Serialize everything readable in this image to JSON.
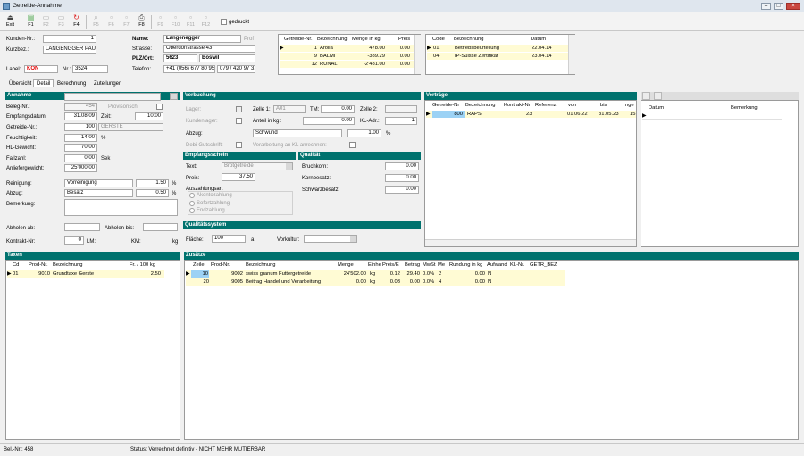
{
  "window": {
    "title": "Getreide-Annahme"
  },
  "toolbar": {
    "exit": "Exit",
    "f1": "F1",
    "f2": "F2",
    "f3": "F3",
    "f4": "F4",
    "f5": "F5",
    "f6": "F6",
    "f7": "F7",
    "f8": "F8",
    "f9": "F9",
    "f10": "F10",
    "f11": "F11",
    "f12": "F12",
    "gedruckt": "gedruckt"
  },
  "header": {
    "kundennr_label": "Kunden-Nr.:",
    "kundennr": "1",
    "kurzbez_label": "Kurzbez.:",
    "kurzbez": "LANGENGGER PAU",
    "label_label": "Label:",
    "label": "KON",
    "nr_label": "Nr.:",
    "nr": "3524",
    "name_label": "Name:",
    "name": "Langenegger",
    "name_extra": "Prof",
    "strasse_label": "Strasse:",
    "strasse": "Oberdorfstrasse 43",
    "plz_label": "PLZ/Ort:",
    "plz": "5623",
    "ort": "Boswil",
    "telefon_label": "Telefon:",
    "telefon": "+41 (056) 677 80 95",
    "telefon2": "079 / 420 97 31"
  },
  "getreide_table": {
    "headers": [
      "Getreide-Nr.",
      "Bezeichnung",
      "Menge in kg",
      "Preis"
    ],
    "rows": [
      [
        "1",
        "Arolla",
        "478.00",
        "0.00"
      ],
      [
        "9",
        "BALMI",
        "-389.29",
        "0.00"
      ],
      [
        "12",
        "RUNAL",
        "-2'481.00",
        "0.00"
      ]
    ]
  },
  "code_table": {
    "headers": [
      "Code",
      "Bezeichnung",
      "Datum"
    ],
    "rows": [
      [
        "01",
        "Betriebsbeurteilung",
        "22.04.14"
      ],
      [
        "04",
        "IP-Suisse Zertifikat",
        "23.04.14"
      ]
    ]
  },
  "tabs": [
    "Übersicht",
    "Detail",
    "Berechnung",
    "Zuteilungen"
  ],
  "annahme": {
    "section": "Annahme",
    "belegnr_label": "Beleg-Nr.:",
    "belegnr": "454",
    "provisorisch": "Provisorisch",
    "empfangsdatum_label": "Empfangsdatum:",
    "empfangsdatum": "31.08.09",
    "zeit_label": "Zeit:",
    "zeit": "10:00",
    "getreidenr_label": "Getreide-Nr.:",
    "getreidenr": "100",
    "getreide": "GERSTE",
    "feuchtigkeit_label": "Feuchtigkeit:",
    "feuchtigkeit": "14.00",
    "feuchtigkeit_unit": "%",
    "hlgewicht_label": "HL-Gewicht:",
    "hlgewicht": "70.00",
    "fallzahl_label": "Fallzahl:",
    "fallzahl": "0.00",
    "fallzahl_unit": "Sek",
    "anliefergewicht_label": "Anliefergewicht:",
    "anliefergewicht": "25'000.00",
    "reinigung_label": "Reinigung:",
    "reinigung": "Vorreinigung",
    "reinigung_val": "1.50",
    "abzug_label": "Abzug:",
    "abzug": "Besatz",
    "abzug_val": "0.50",
    "bemerkung_label": "Bemerkung:",
    "abholen_ab_label": "Abholen ab:",
    "abholen_bis_label": "Abholen bis:",
    "kontraktnr_label": "Kontrakt-Nr:",
    "kontraktnr": "0",
    "lm": "LM:",
    "km": "KM:",
    "kg": "kg"
  },
  "verbuchung": {
    "section": "Verbuchung",
    "lager_label": "Lager:",
    "zelle1_label": "Zelle 1:",
    "zelle1": "A01",
    "tm_label": "TM:",
    "tm": "0.00",
    "zelle2_label": "Zelle 2:",
    "kundenlager_label": "Kundenlager:",
    "anteil_label": "Anteil in kg:",
    "anteil": "0.00",
    "kladr_label": "KL-Adr.:",
    "kladr": "1",
    "abzug_label": "Abzug:",
    "abzug": "Schwund",
    "abzug_val": "1.00",
    "pct": "%",
    "debi_label": "Debi-Gutschrift:",
    "verarbeitung_label": "Verarbeitung an KL anrechnen:"
  },
  "empfangsschein": {
    "section": "Empfangsschein",
    "text_label": "Text:",
    "text": "Brotgetreide",
    "preis_label": "Preis:",
    "preis": "37.50",
    "auszahlungsart": "Auszahlungsart",
    "opts": [
      "Akontozahlung",
      "Sofortzahlung",
      "Endzahlung"
    ]
  },
  "qualitaet": {
    "section": "Qualität",
    "bruchkorn_label": "Bruchkorn:",
    "bruchkorn": "0.00",
    "kornbesatz_label": "Kornbesatz:",
    "kornbesatz": "0.00",
    "schwarzbesatz_label": "Schwarzbesatz:",
    "schwarzbesatz": "0.00"
  },
  "qualitaetssystem": {
    "section": "Qualitätssystem",
    "flaeche_label": "Fläche:",
    "flaeche": "100",
    "flaeche_unit": "a",
    "vorkultur_label": "Vorkultur:"
  },
  "vertraege": {
    "section": "Verträge",
    "headers": [
      "Getreide-Nr",
      "Bezeichnung",
      "Kontrakt-Nr",
      "Referenz",
      "von",
      "bis",
      "nge"
    ],
    "rows": [
      [
        "800",
        "RAPS",
        "23",
        "",
        "01.06.22",
        "31.05.23",
        "15"
      ]
    ]
  },
  "right_panel": {
    "headers": [
      "Datum",
      "Bemerkung"
    ]
  },
  "taxen": {
    "section": "Taxen",
    "headers": [
      "Cd",
      "Prod-Nr.",
      "Bezeichnung",
      "Fr. / 100 kg"
    ],
    "rows": [
      [
        "01",
        "9010",
        "Grundtaxe Gerste",
        "2.50"
      ]
    ]
  },
  "zusaetze": {
    "section": "Zusätze",
    "headers": [
      "Zeile",
      "Prod-Nr.",
      "Bezeichnung",
      "Menge",
      "Einhe",
      "Preis/E",
      "Betrag",
      "MwSt",
      "Me",
      "Rundung in kg",
      "Aufwand",
      "KL-Nr.",
      "GETR_BEZ"
    ],
    "rows": [
      [
        "10",
        "9002",
        "swiss granum Futtergetreide",
        "24'502.00",
        "kg",
        "0.12",
        "29.40",
        "0.0%",
        "2",
        "0.00",
        "N",
        "",
        ""
      ],
      [
        "20",
        "9005",
        "Beitrag Handel und Verarbeitung",
        "0.00",
        "kg",
        "0.03",
        "0.00",
        "0.0%",
        "4",
        "0.00",
        "N",
        "",
        ""
      ]
    ]
  },
  "status": {
    "belnr": "Bel.-Nr.: 458",
    "text": "Status: Verrechnet definitiv - NICHT MEHR MUTIERBAR"
  }
}
